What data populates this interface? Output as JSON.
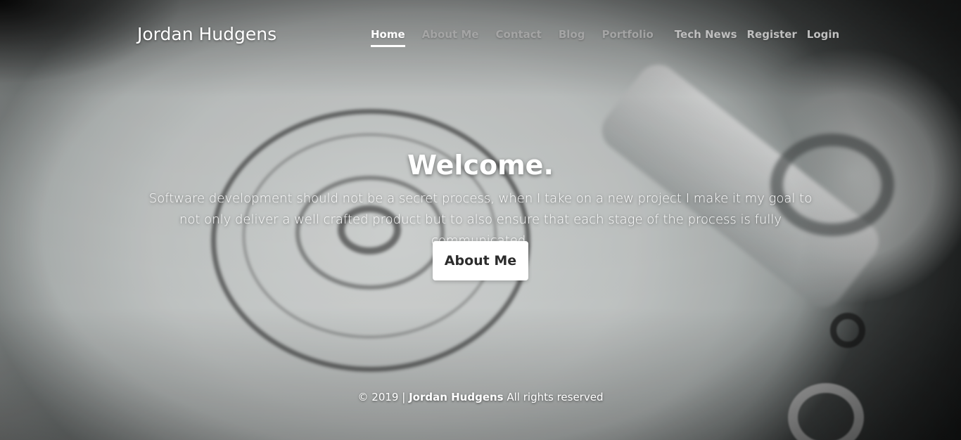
{
  "header": {
    "brand": "Jordan Hudgens",
    "nav": [
      {
        "label": "Home",
        "active": true
      },
      {
        "label": "About Me"
      },
      {
        "label": "Contact"
      },
      {
        "label": "Blog"
      },
      {
        "label": "Portfolio"
      },
      {
        "label": "Tech News"
      },
      {
        "label": "Register"
      },
      {
        "label": "Login"
      }
    ]
  },
  "hero": {
    "title": "Welcome.",
    "text": "Software development should not be a secret process, when I take on a new project I make it my goal to not only deliver a well crafted product but to also ensure that each stage of the process is fully communicated.",
    "button_label": "About Me"
  },
  "footer": {
    "copyright": "© 2019 |",
    "name": "Jordan Hudgens",
    "rights": "All rights reserved"
  },
  "colors": {
    "text": "#ffffff",
    "nav_inactive": "#aaaaaa",
    "button_bg": "#ffffff",
    "button_text": "#2c2c2c"
  },
  "background": {
    "image": "hard-drive-platter"
  }
}
